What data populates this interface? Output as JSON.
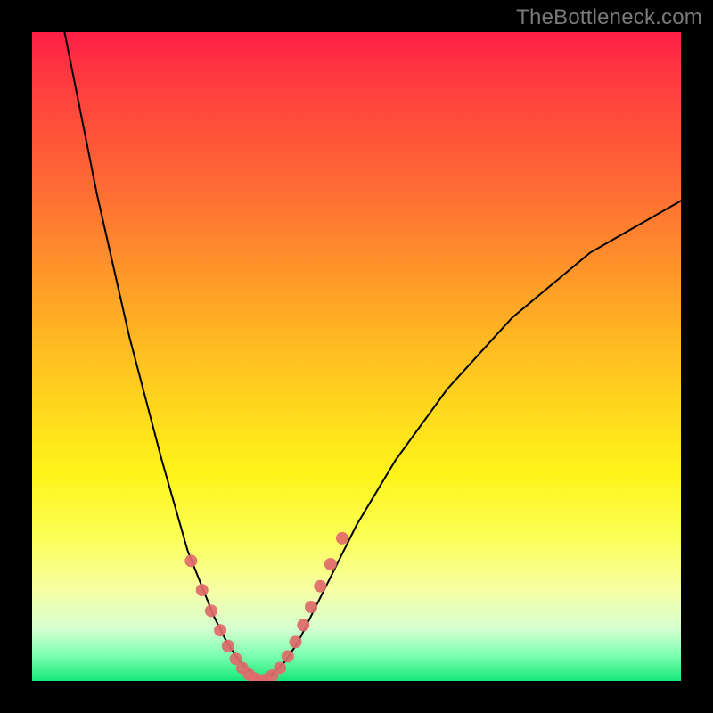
{
  "watermark": "TheBottleneck.com",
  "chart_data": {
    "type": "line",
    "title": "",
    "xlabel": "",
    "ylabel": "",
    "xlim": [
      0,
      100
    ],
    "ylim": [
      0,
      100
    ],
    "grid": false,
    "legend": false,
    "annotations": [],
    "series": [
      {
        "name": "curve-left",
        "color": "#000000",
        "x": [
          5,
          10,
          15,
          20,
          24,
          26,
          28,
          30,
          32,
          34,
          35
        ],
        "y": [
          100,
          75,
          53,
          34,
          20,
          15,
          10,
          6,
          3,
          1,
          0
        ]
      },
      {
        "name": "curve-right",
        "color": "#000000",
        "x": [
          35,
          37,
          39,
          41,
          43,
          46,
          50,
          56,
          64,
          74,
          86,
          100
        ],
        "y": [
          0,
          1,
          3,
          6,
          10,
          16,
          24,
          34,
          45,
          56,
          66,
          74
        ]
      },
      {
        "name": "markers-left",
        "color": "#e06a6a",
        "type": "scatter",
        "x": [
          24.5,
          26.2,
          27.6,
          29.0,
          30.2,
          31.4,
          32.4,
          33.4,
          34.2,
          35.0
        ],
        "y": [
          18.5,
          14.0,
          10.8,
          7.8,
          5.4,
          3.4,
          2.0,
          1.0,
          0.4,
          0.1
        ]
      },
      {
        "name": "markers-right",
        "color": "#e06a6a",
        "type": "scatter",
        "x": [
          36.0,
          37.0,
          38.2,
          39.4,
          40.6,
          41.8,
          43.0,
          44.4,
          46.0,
          47.8
        ],
        "y": [
          0.2,
          0.8,
          2.0,
          3.8,
          6.0,
          8.6,
          11.4,
          14.6,
          18.0,
          22.0
        ]
      }
    ]
  }
}
